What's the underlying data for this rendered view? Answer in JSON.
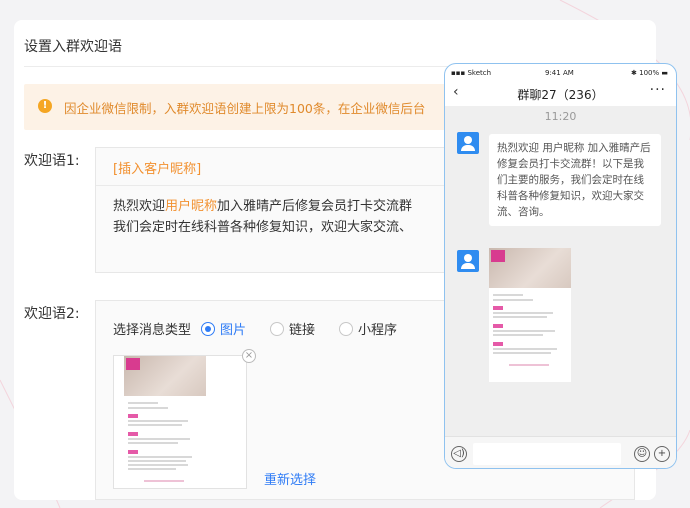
{
  "page": {
    "title": "设置入群欢迎语"
  },
  "notice": {
    "icon": "warning-icon",
    "text": "因企业微信限制，入群欢迎语创建上限为100条，在企业微信后台"
  },
  "welcome1": {
    "label": "欢迎语1:",
    "insert_nickname": "[插入客户昵称]",
    "line1_pre": "热烈欢迎",
    "line1_nick": "用户昵称",
    "line1_post": "加入雅晴产后修复会员打卡交流群",
    "line2": "我们会定时在线科普各种修复知识，欢迎大家交流、"
  },
  "welcome2": {
    "label": "欢迎语2:",
    "msg_type_label": "选择消息类型",
    "options": [
      {
        "label": "图片",
        "checked": true
      },
      {
        "label": "链接",
        "checked": false
      },
      {
        "label": "小程序",
        "checked": false
      }
    ],
    "reselect": "重新选择",
    "close_icon": "×"
  },
  "phone": {
    "carrier": "Sketch",
    "time": "9:41 AM",
    "battery": "100%",
    "chat_title": "群聊27（236）",
    "back": "‹",
    "more": "···",
    "msg_time": "11:20",
    "message": "热烈欢迎 用户昵称 加入雅晴产后修复会员打卡交流群！以下是我们主要的服务，我们会定时在线科普各种修复知识，欢迎大家交流、咨询。",
    "voice_icon": "◁)",
    "emoji_icon": "☺",
    "plus_icon": "+"
  }
}
